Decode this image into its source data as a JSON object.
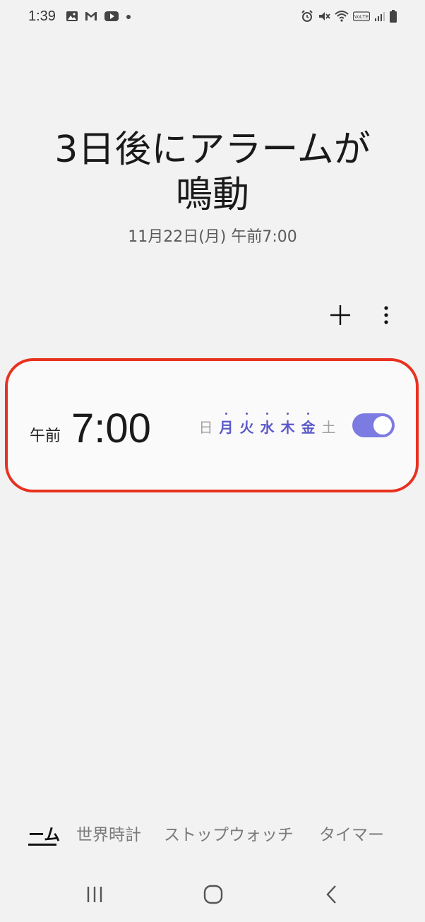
{
  "status_bar": {
    "time": "1:39",
    "left_icons": [
      "image-icon",
      "gmail-icon",
      "youtube-icon",
      "dot-icon"
    ],
    "right_icons": [
      "alarm-icon",
      "mute-icon",
      "wifi-icon",
      "volte-icon",
      "signal-icon",
      "battery-icon"
    ],
    "volte_label": "VoLTE"
  },
  "header": {
    "line1": "3日後にアラームが",
    "line2": "鳴動",
    "next_alarm": "11月22日(月) 午前7:00"
  },
  "toolbar": {
    "add_icon": "plus-icon",
    "more_icon": "more-vertical-icon"
  },
  "alarm": {
    "ampm": "午前",
    "time": "7:00",
    "days": [
      {
        "label": "日",
        "active": false
      },
      {
        "label": "月",
        "active": true
      },
      {
        "label": "火",
        "active": true
      },
      {
        "label": "水",
        "active": true
      },
      {
        "label": "木",
        "active": true
      },
      {
        "label": "金",
        "active": true
      },
      {
        "label": "土",
        "active": false
      }
    ],
    "enabled": true,
    "accent_color": "#7c7be2",
    "highlight_border_color": "#e8311f"
  },
  "tabs": [
    {
      "label": "ーム",
      "active": true
    },
    {
      "label": "世界時計",
      "active": false
    },
    {
      "label": "ストップウォッチ",
      "active": false
    },
    {
      "label": "タイマー",
      "active": false
    }
  ],
  "navbar": {
    "recents_icon": "recents-icon",
    "home_icon": "home-icon",
    "back_icon": "back-icon"
  }
}
